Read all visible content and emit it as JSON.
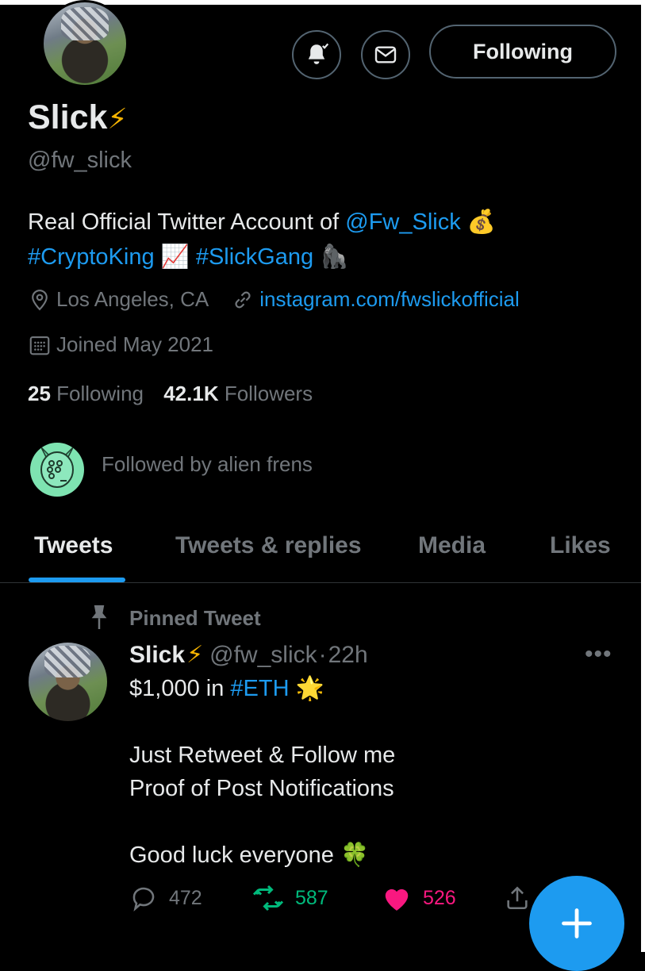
{
  "profile": {
    "name": "Slick",
    "name_emoji": "⚡",
    "handle": "@fw_slick",
    "bio_line1_text": "Real Official Twitter Account of ",
    "bio_line1_mention": "@Fw_Slick",
    "bio_line1_emoji": "💰",
    "bio_hashtag1": "#CryptoKing",
    "bio_emoji2": "📈",
    "bio_hashtag2": "#SlickGang",
    "bio_emoji3": "🦍",
    "location": "Los Angeles, CA",
    "website": "instagram.com/fwslickofficial",
    "joined": "Joined May 2021",
    "following_count": "25",
    "following_label": "Following",
    "followers_count": "42.1K",
    "followers_label": "Followers",
    "followed_by": "Followed by alien frens"
  },
  "header_actions": {
    "following_button": "Following"
  },
  "tabs": [
    {
      "label": "Tweets",
      "active": true
    },
    {
      "label": "Tweets & replies",
      "active": false
    },
    {
      "label": "Media",
      "active": false
    },
    {
      "label": "Likes",
      "active": false
    }
  ],
  "pinned_tweet": {
    "pinned_label": "Pinned Tweet",
    "author_name": "Slick",
    "author_emoji": "⚡",
    "author_handle": "@fw_slick",
    "separator": "·",
    "time": "22h",
    "more": "•••",
    "line1_text": "$1,000 in ",
    "line1_hashtag": "#ETH",
    "line1_emoji": "🌟",
    "line2": "Just Retweet & Follow me",
    "line3": "Proof of Post Notifications",
    "line4_text": "Good luck everyone ",
    "line4_emoji": "🍀",
    "replies": "472",
    "retweets": "587",
    "likes": "526"
  },
  "colors": {
    "background": "#000000",
    "accent": "#1d9bf0",
    "secondary_text": "#71767b",
    "retweet_green": "#00ba7c",
    "like_pink": "#f91880"
  },
  "icons": [
    "bell-subscribed-icon",
    "mail-icon",
    "location-icon",
    "link-icon",
    "calendar-icon",
    "pin-icon",
    "reply-icon",
    "retweet-icon",
    "heart-icon",
    "share-icon",
    "compose-plus-icon"
  ]
}
